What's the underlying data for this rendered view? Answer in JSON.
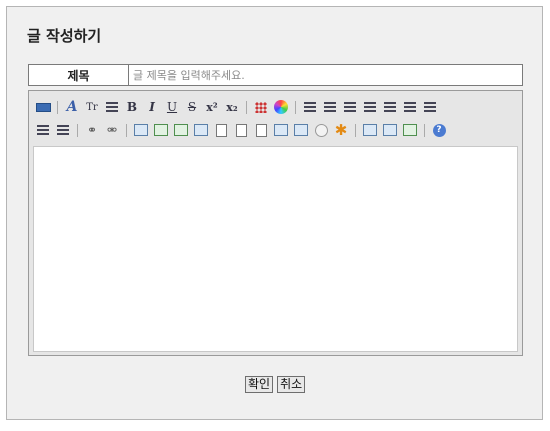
{
  "page": {
    "heading": "글 작성하기"
  },
  "form": {
    "title_label": "제목",
    "title_value": "",
    "title_placeholder": "글 제목을 입력해주세요."
  },
  "toolbar": {
    "row1": [
      {
        "name": "html-mode",
        "icon": "html-icon"
      },
      {
        "name": "font-family",
        "icon": "font-icon",
        "glyph": "A"
      },
      {
        "name": "font-size",
        "icon": "font-size-icon",
        "glyph": "Tr"
      },
      {
        "name": "line-height",
        "icon": "line-height-icon"
      },
      {
        "name": "bold",
        "icon": "bold-icon",
        "glyph": "B"
      },
      {
        "name": "italic",
        "icon": "italic-icon",
        "glyph": "I"
      },
      {
        "name": "underline",
        "icon": "underline-icon",
        "glyph": "U"
      },
      {
        "name": "strikethrough",
        "icon": "strikethrough-icon",
        "glyph": "S"
      },
      {
        "name": "superscript",
        "icon": "superscript-icon",
        "glyph": "x²"
      },
      {
        "name": "subscript",
        "icon": "subscript-icon",
        "glyph": "x₂"
      },
      {
        "name": "text-color",
        "icon": "palette-icon"
      },
      {
        "name": "background-color",
        "icon": "color-wheel-icon"
      },
      {
        "name": "align-left",
        "icon": "align-left-icon"
      },
      {
        "name": "align-center",
        "icon": "align-center-icon"
      },
      {
        "name": "align-right",
        "icon": "align-right-icon"
      },
      {
        "name": "indent",
        "icon": "indent-icon"
      },
      {
        "name": "outdent",
        "icon": "outdent-icon"
      },
      {
        "name": "bullet-list",
        "icon": "bullet-list-icon"
      },
      {
        "name": "numbered-list",
        "icon": "numbered-list-icon"
      }
    ],
    "row2": [
      {
        "name": "justify",
        "icon": "justify-icon"
      },
      {
        "name": "align-none",
        "icon": "align-none-icon"
      },
      {
        "name": "link",
        "icon": "link-icon"
      },
      {
        "name": "unlink",
        "icon": "unlink-icon"
      },
      {
        "name": "table",
        "icon": "table-icon"
      },
      {
        "name": "image",
        "icon": "image-icon"
      },
      {
        "name": "image-gallery",
        "icon": "image-gallery-icon"
      },
      {
        "name": "copy",
        "icon": "copy-icon"
      },
      {
        "name": "file",
        "icon": "file-icon"
      },
      {
        "name": "media",
        "icon": "media-icon"
      },
      {
        "name": "page",
        "icon": "page-icon"
      },
      {
        "name": "list-box",
        "icon": "list-box-icon"
      },
      {
        "name": "insert-object",
        "icon": "insert-object-icon"
      },
      {
        "name": "emoticon",
        "icon": "emoticon-icon"
      },
      {
        "name": "special-char",
        "icon": "special-char-icon"
      },
      {
        "name": "preview",
        "icon": "preview-icon"
      },
      {
        "name": "print",
        "icon": "print-icon"
      },
      {
        "name": "fullscreen",
        "icon": "fullscreen-icon"
      },
      {
        "name": "help",
        "icon": "help-icon"
      }
    ]
  },
  "editor": {
    "content": ""
  },
  "actions": {
    "confirm_label": "확인",
    "cancel_label": "취소"
  },
  "colors": {
    "panel_bg": "#f0f0f0",
    "toolbar_bg": "#e6e6e6",
    "border": "#7a7a7a"
  }
}
